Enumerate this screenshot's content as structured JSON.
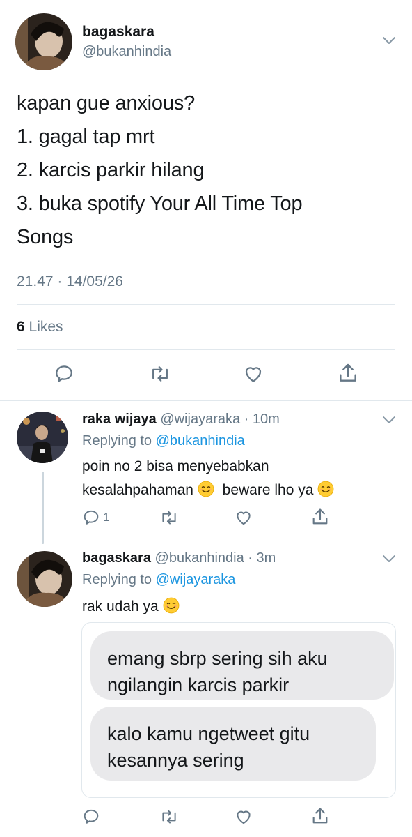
{
  "main_tweet": {
    "name": "bagaskara",
    "handle": "@bukanhindia",
    "lines": [
      "kapan gue anxious?",
      "1. gagal tap mrt",
      "2. karcis parkir hilang",
      "3. buka spotify Your All Time Top",
      "Songs"
    ],
    "timestamp": "21.47 · 14/05/26",
    "likes_count": "6",
    "likes_label": "Likes"
  },
  "reply1": {
    "name": "raka wijaya",
    "handle": "@wijayaraka",
    "time": "· 10m",
    "replying_prefix": "Replying to",
    "replying_to": "@bukanhindia",
    "text_line1": "poin no 2 bisa menyebabkan",
    "text_line2_a": "kesalahpahaman",
    "text_line2_b": "beware lho ya",
    "reply_count": "1"
  },
  "reply2": {
    "name": "bagaskara",
    "handle": "@bukanhindia",
    "time": "· 3m",
    "replying_prefix": "Replying to",
    "replying_to": "@wijayaraka",
    "text": "rak udah ya",
    "bubble1": [
      "emang sbrp sering sih aku",
      "ngilangin karcis parkir"
    ],
    "bubble2": [
      "kalo kamu ngetweet gitu",
      "kesannya sering"
    ]
  },
  "icons": {
    "chevron": "chevron-down-icon",
    "reply": "reply-icon",
    "retweet": "retweet-icon",
    "like": "heart-icon",
    "share": "share-icon",
    "emoji": "smiling-face-emoji"
  },
  "colors": {
    "text": "#14171a",
    "muted": "#657786",
    "link": "#1b95e0",
    "divider": "#e1e8ed",
    "bubble": "#e9e9eb",
    "thread_line": "#ccd6dd"
  }
}
